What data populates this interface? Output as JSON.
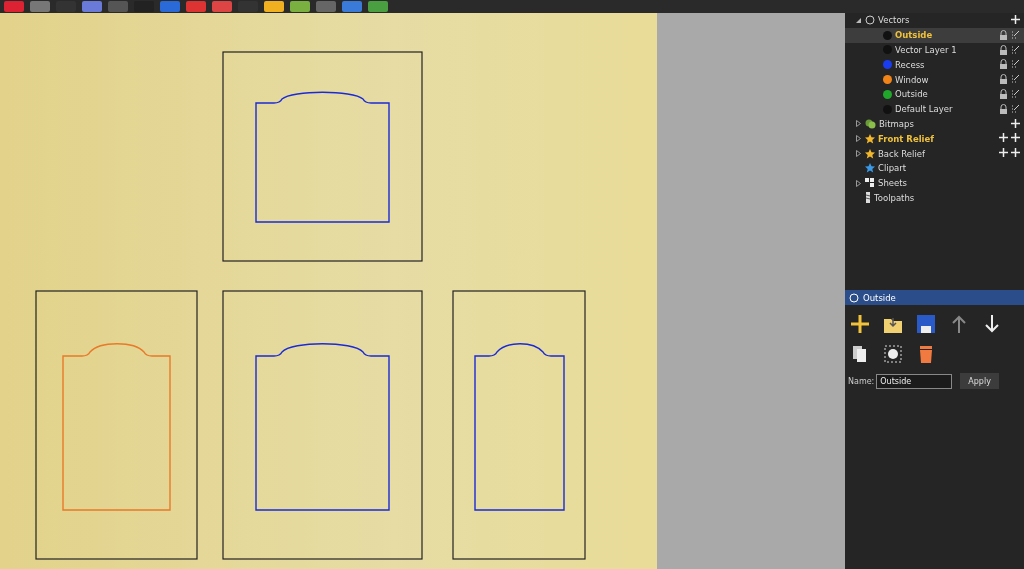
{
  "tree": [
    {
      "label": "Vectors",
      "expanded": true,
      "active": false,
      "kind": "vectors",
      "children": [
        {
          "label": "Outside",
          "color": "#111111",
          "selected": true,
          "active": true
        },
        {
          "label": "Vector Layer 1",
          "color": "#111111",
          "selected": false,
          "active": false
        },
        {
          "label": "Recess",
          "color": "#1a3cf0",
          "selected": false,
          "active": false
        },
        {
          "label": "Window",
          "color": "#f08418",
          "selected": false,
          "active": false
        },
        {
          "label": "Outside",
          "color": "#1fa82a",
          "selected": false,
          "active": false
        },
        {
          "label": "Default Layer",
          "color": "#111111",
          "selected": false,
          "active": false
        }
      ]
    },
    {
      "label": "Bitmaps",
      "expanded": false,
      "active": false,
      "kind": "bitmaps"
    },
    {
      "label": "Front Relief",
      "expanded": false,
      "active": true,
      "kind": "relief"
    },
    {
      "label": "Back Relief",
      "expanded": false,
      "active": false,
      "kind": "relief"
    },
    {
      "label": "Clipart",
      "active": false,
      "kind": "clipart"
    },
    {
      "label": "Sheets",
      "expanded": false,
      "active": false,
      "kind": "sheets"
    },
    {
      "label": "Toolpaths",
      "active": false,
      "kind": "toolpaths"
    }
  ],
  "panel": {
    "title": "Outside",
    "name_label": "Name:",
    "name_value": "Outside",
    "apply": "Apply"
  }
}
